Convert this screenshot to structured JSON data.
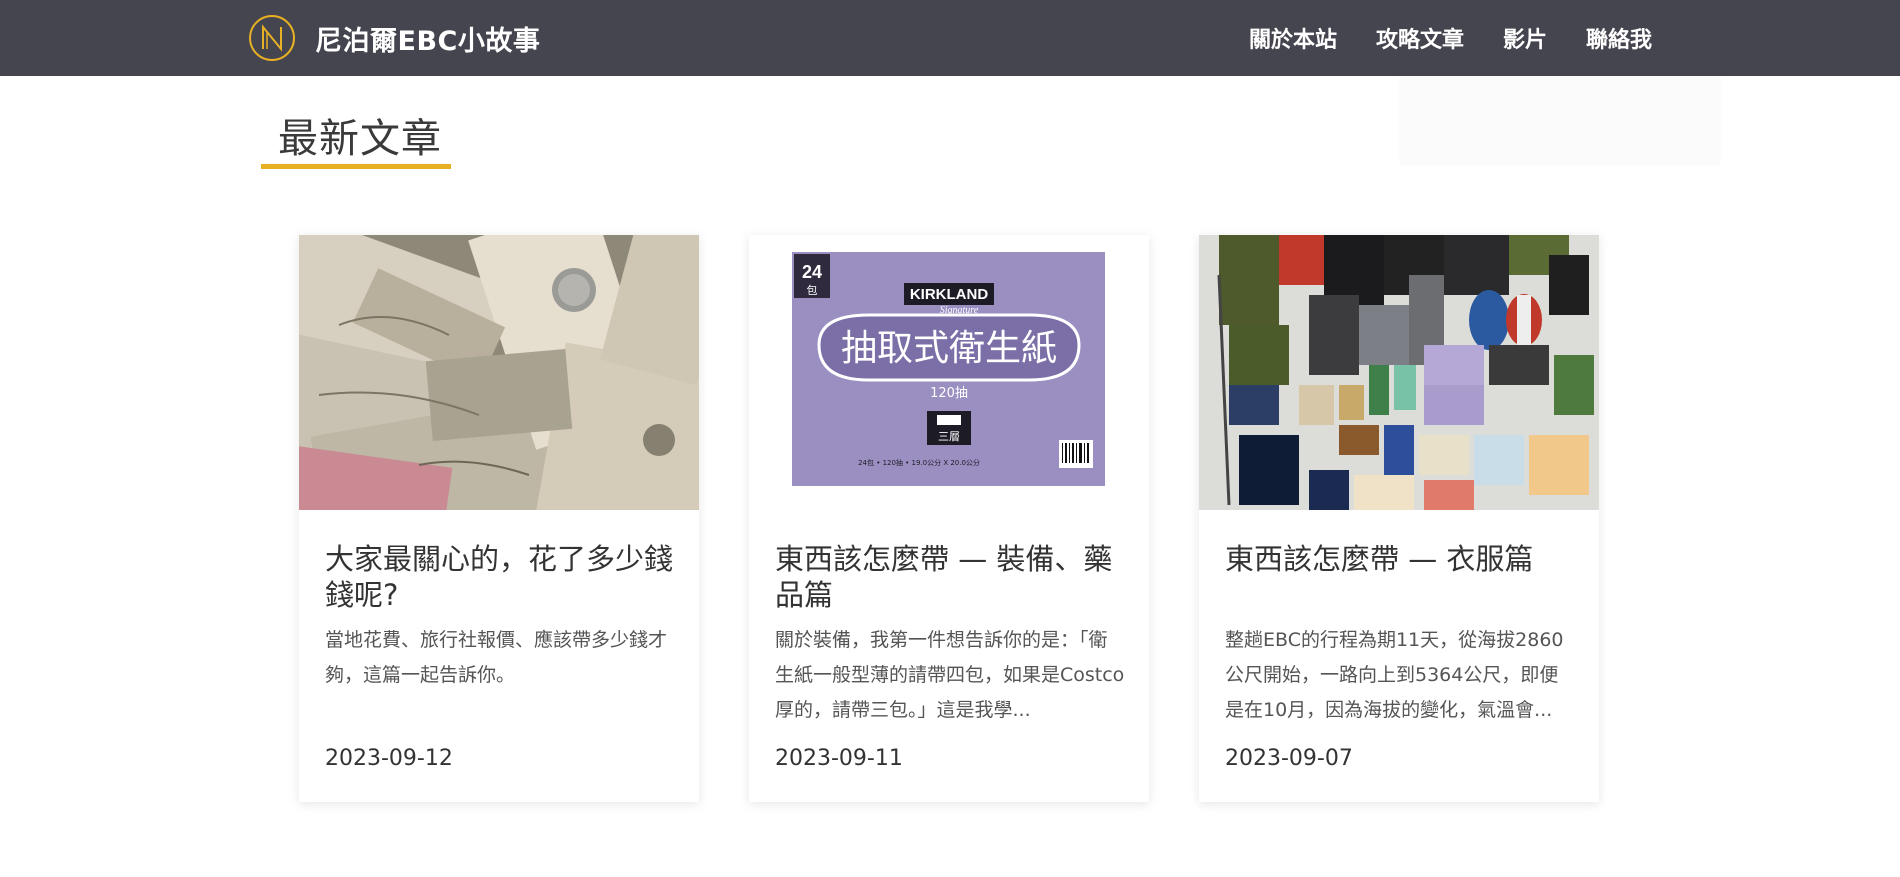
{
  "site": {
    "brand_name": "尼泊爾EBC小故事",
    "logo_icon": "n-circle-logo-icon",
    "accent_color": "#e8b023",
    "navbar_color": "#45454f"
  },
  "nav": {
    "items": [
      {
        "label": "關於本站"
      },
      {
        "label": "攻略文章"
      },
      {
        "label": "影片"
      },
      {
        "label": "聯絡我"
      }
    ]
  },
  "section": {
    "title": "最新文章"
  },
  "posts": [
    {
      "title": "大家最關心的，花了多少錢錢呢?",
      "excerpt": "當地花費、旅行社報價、應該帶多少錢才夠，這篇一起告訴你。",
      "date": "2023-09-12",
      "image": "nepali-rupee-banknotes-photo"
    },
    {
      "title": "東西該怎麼帶 — 裝備、藥品篇",
      "excerpt": "關於裝備，我第一件想告訴你的是：「衛生紙一般型薄的請帶四包，如果是Costco厚的，請帶三包。」這是我學...",
      "date": "2023-09-11",
      "image": "kirkland-tissue-box-photo",
      "image_text": {
        "count": "24",
        "count_unit": "包",
        "brand": "KIRKLAND",
        "brand_sub": "Signature",
        "product": "抽取式衛生紙",
        "sheets": "120抽",
        "ply": "三層",
        "spec": "24包 • 120抽 • 19.0公分 X 20.0公分"
      }
    },
    {
      "title": "東西該怎麼帶 — 衣服篇",
      "excerpt": "整趟EBC的行程為期11天，從海拔2860公尺開始，一路向上到5364公尺，即便是在10月，因為海拔的變化，氣溫會...",
      "date": "2023-09-07",
      "image": "packing-gear-flatlay-photo"
    }
  ]
}
